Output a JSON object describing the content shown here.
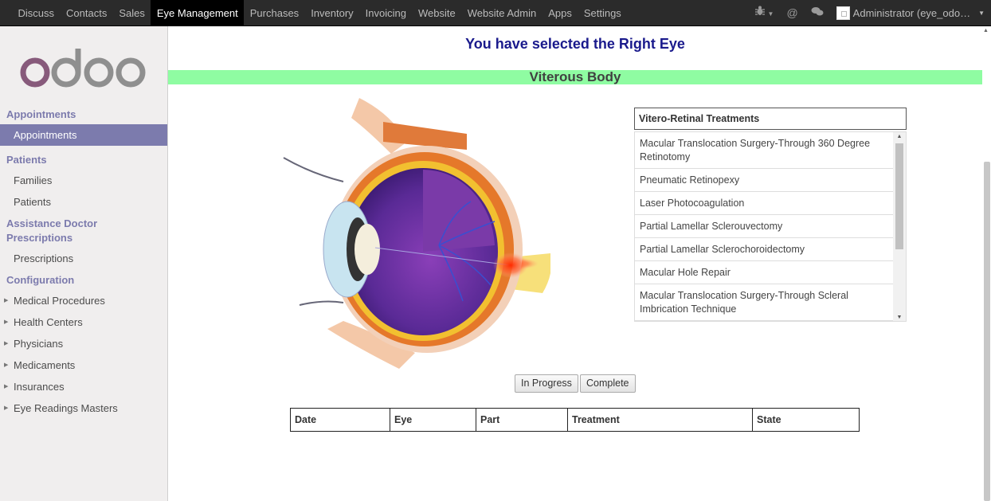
{
  "navbar": {
    "menu": [
      "Discuss",
      "Contacts",
      "Sales",
      "Eye Management",
      "Purchases",
      "Inventory",
      "Invoicing",
      "Website",
      "Website Admin",
      "Apps",
      "Settings"
    ],
    "active": "Eye Management",
    "user_label": "Administrator (eye_odo…"
  },
  "sidebar": {
    "logo_text": "odoo",
    "sections": [
      {
        "title": "Appointments",
        "items": [
          {
            "label": "Appointments",
            "active": true
          }
        ]
      },
      {
        "title": "Patients",
        "items": [
          {
            "label": "Families"
          },
          {
            "label": "Patients"
          }
        ]
      },
      {
        "title": "Assistance Doctor Prescriptions",
        "items": [
          {
            "label": "Prescriptions"
          }
        ]
      },
      {
        "title": "Configuration",
        "items": [
          {
            "label": "Medical Procedures",
            "expandable": true
          },
          {
            "label": "Health Centers",
            "expandable": true
          },
          {
            "label": "Physicians",
            "expandable": true
          },
          {
            "label": "Medicaments",
            "expandable": true
          },
          {
            "label": "Insurances",
            "expandable": true
          },
          {
            "label": "Eye Readings Masters",
            "expandable": true
          }
        ]
      }
    ]
  },
  "main": {
    "headline": "You have selected the Right Eye",
    "section_title": "Viterous Body",
    "treatments": {
      "header": "Vitero-Retinal Treatments",
      "items": [
        "Macular Translocation Surgery-Through 360 Degree Retinotomy",
        "Pneumatic Retinopexy",
        "Laser Photocoagulation",
        "Partial Lamellar Sclerouvectomy",
        "Partial Lamellar Sclerochoroidectomy",
        "Macular Hole Repair",
        "Macular Translocation Surgery-Through Scleral Imbrication Technique"
      ]
    },
    "buttons": {
      "in_progress": "In Progress",
      "complete": "Complete"
    },
    "history_table": {
      "columns": [
        "Date",
        "Eye",
        "Part",
        "Treatment",
        "State"
      ]
    }
  },
  "colors": {
    "navbar_bg": "#2b2b2b",
    "sidebar_accent": "#7c7bad",
    "headline": "#1a1a8c",
    "section_bar": "#8ffca2",
    "logo_o": "#875a7b",
    "logo_text": "#8f8f8f"
  }
}
